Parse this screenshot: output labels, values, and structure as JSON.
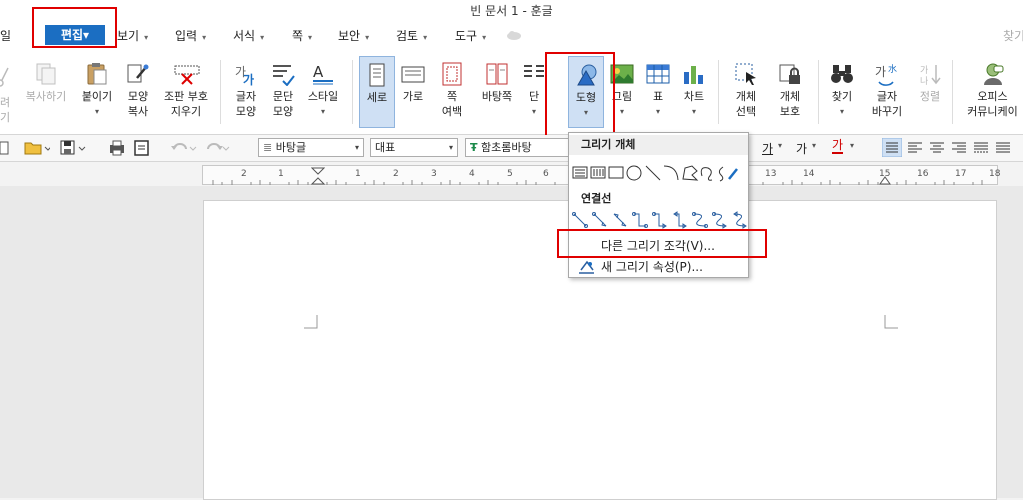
{
  "window": {
    "title": "빈 문서 1 - 훈글",
    "right_label": "찾기"
  },
  "menu": {
    "left_cut": "일",
    "items": [
      {
        "label": "편집",
        "arrow": "▾"
      },
      {
        "label": "보기",
        "arrow": "▾"
      },
      {
        "label": "입력",
        "arrow": "▾"
      },
      {
        "label": "서식",
        "arrow": "▾"
      },
      {
        "label": "쪽",
        "arrow": "▾"
      },
      {
        "label": "보안",
        "arrow": "▾"
      },
      {
        "label": "검토",
        "arrow": "▾"
      },
      {
        "label": "도구",
        "arrow": "▾"
      }
    ]
  },
  "ribbon": {
    "cut_labels": [
      "려",
      "기"
    ],
    "copy": "복사하기",
    "paste": "붙이기",
    "format_copy": [
      "모양",
      "복사"
    ],
    "clear_code": [
      "조판 부호",
      "지우기"
    ],
    "char_shape": [
      "글자",
      "모양"
    ],
    "para_shape": [
      "문단",
      "모양"
    ],
    "style": "스타일",
    "portrait": "세로",
    "landscape": "가로",
    "margin": [
      "쪽",
      "여백"
    ],
    "background": "바탕쪽",
    "column": "단",
    "shape": "도형",
    "picture": "그림",
    "table": "표",
    "chart": "차트",
    "obj_select": [
      "개체",
      "선택"
    ],
    "obj_protect": [
      "개체",
      "보호"
    ],
    "find": "찾기",
    "replace": [
      "글자",
      "바꾸기"
    ],
    "arrange": "정렬",
    "office": [
      "오피스",
      "커뮤니케이"
    ],
    "dd_arrow": "▾"
  },
  "toolbar": {
    "style_combo": "바탕글",
    "lang_combo": "대표",
    "font_combo": "함초롬바탕",
    "font_icon": "Ŧ",
    "char1": "가",
    "char2": "가",
    "char3": "가"
  },
  "ruler": {
    "numbers": [
      "2",
      "1",
      "1",
      "2",
      "3",
      "4",
      "5",
      "6",
      "13",
      "14",
      "15",
      "16",
      "17",
      "18"
    ]
  },
  "dropdown": {
    "section_drawing": "그리기 개체",
    "section_connector": "연결선",
    "item_more": "다른 그리기 조각(V)...",
    "item_props": "새 그리기 속성(P)..."
  },
  "colors": {
    "accent": "#1b6ec2",
    "highlight_red": "#e00000"
  }
}
